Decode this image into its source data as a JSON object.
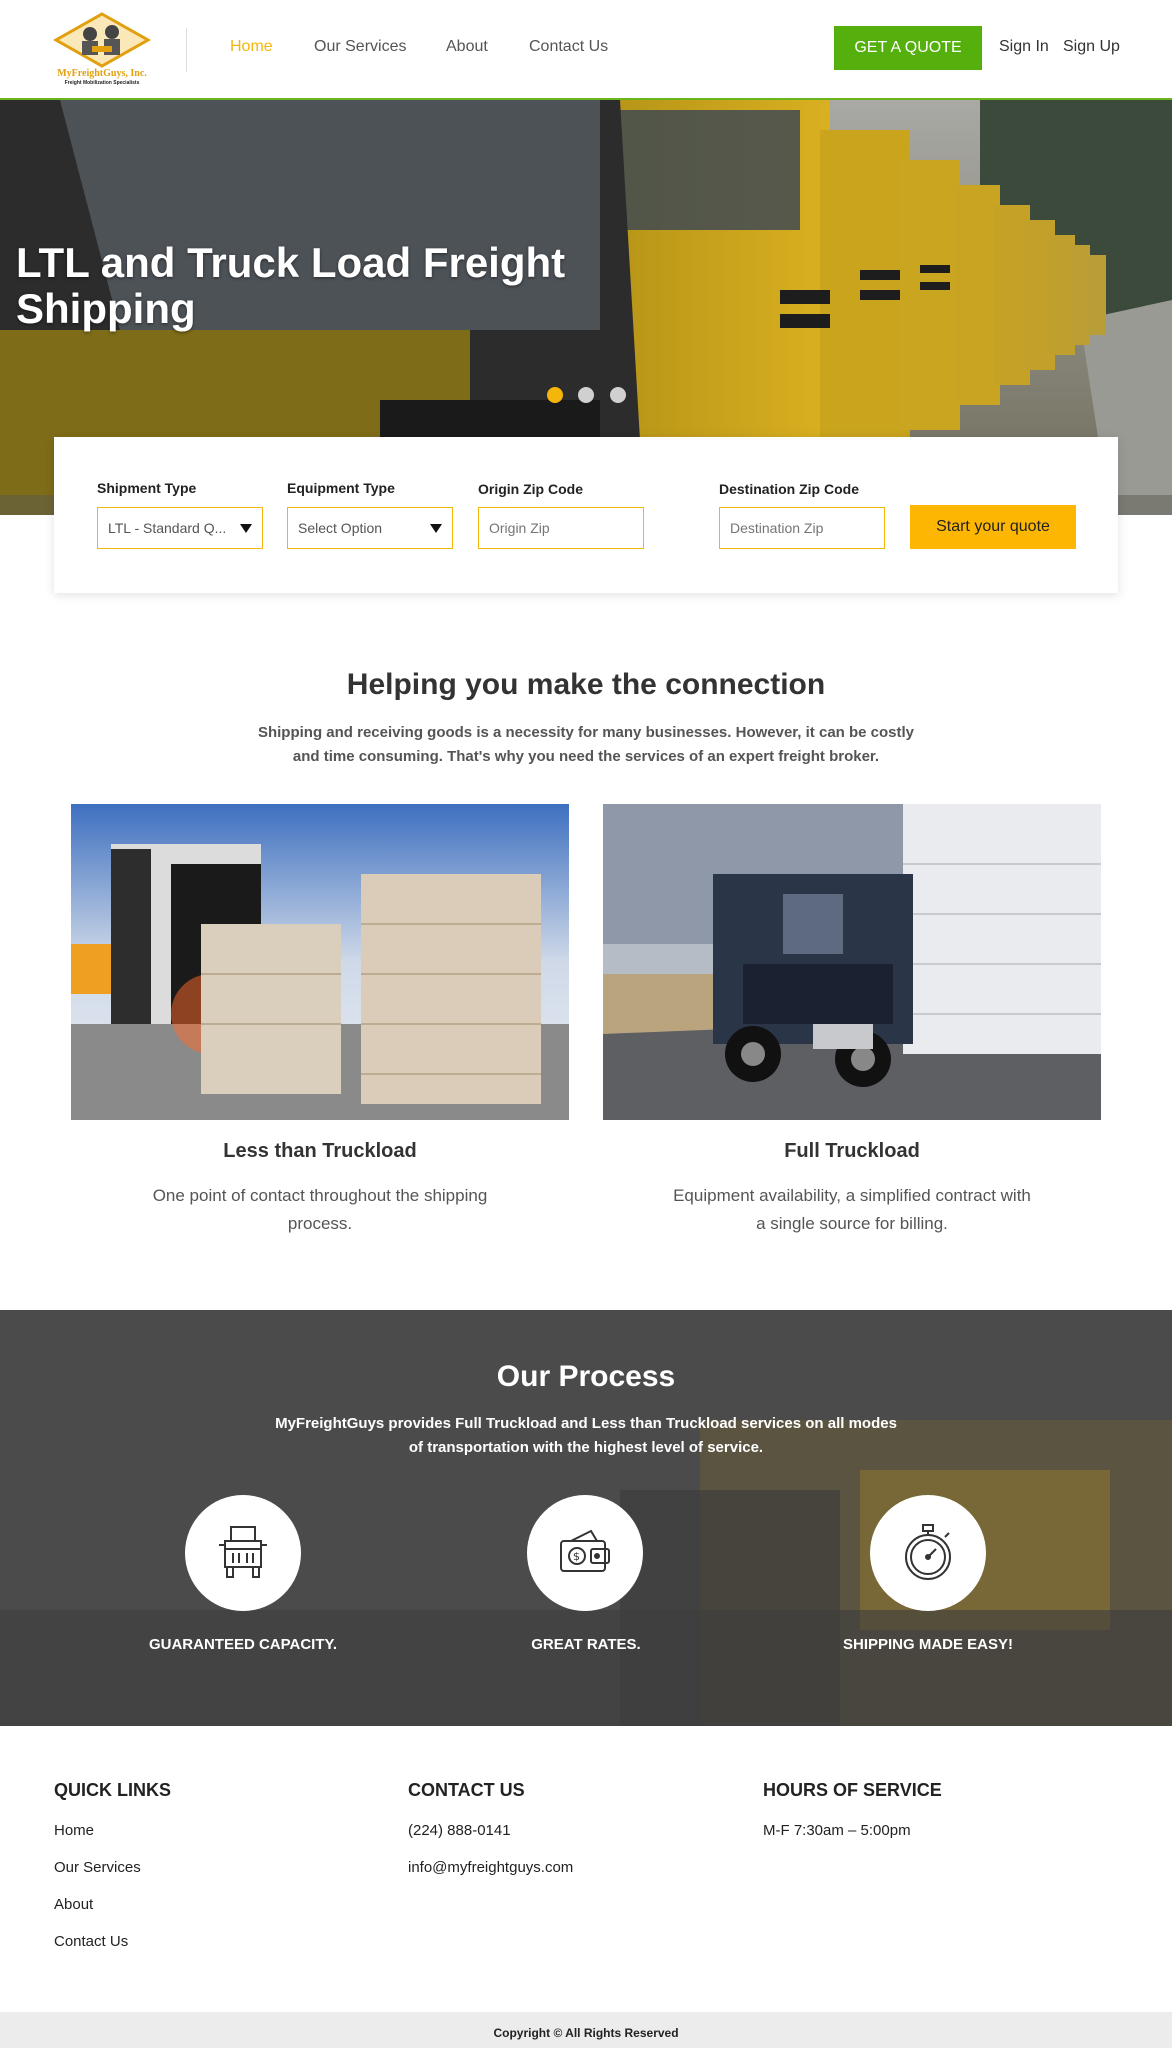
{
  "header": {
    "logo_text": "MyFreightGuys, Inc.",
    "logo_tagline": "Freight Mobilization Specialists",
    "nav": [
      {
        "label": "Home",
        "active": true
      },
      {
        "label": "Our Services",
        "active": false
      },
      {
        "label": "About",
        "active": false
      },
      {
        "label": "Contact Us",
        "active": false
      }
    ],
    "quote_button": "GET A QUOTE",
    "sign_in": "Sign In",
    "sign_up": "Sign Up"
  },
  "hero": {
    "title": "LTL and Truck Load Freight Shipping",
    "slides_total": 3,
    "active_slide": 1
  },
  "quote_form": {
    "shipment_label": "Shipment Type",
    "shipment_value": "LTL - Standard Q...",
    "equipment_label": "Equipment Type",
    "equipment_value": "Select Option",
    "origin_label": "Origin Zip Code",
    "origin_placeholder": "Origin Zip",
    "destination_label": "Destination Zip Code",
    "destination_placeholder": "Destination Zip",
    "submit": "Start your quote"
  },
  "connection": {
    "title": "Helping you make the connection",
    "description": "Shipping and receiving goods is a necessity for many businesses. However, it can be costly and time consuming. That's why you need the services of an expert freight broker.",
    "cards": [
      {
        "title": "Less than Truckload",
        "description": "One point of contact throughout the shipping process."
      },
      {
        "title": "Full Truckload",
        "description": "Equipment availability, a simplified contract with a single source for billing."
      }
    ]
  },
  "process": {
    "title": "Our Process",
    "description": "MyFreightGuys provides Full Truckload and Less than Truckload services on all modes of transportation with the highest level of service.",
    "items": [
      {
        "label": "GUARANTEED CAPACITY.",
        "icon": "truck-icon"
      },
      {
        "label": "GREAT RATES.",
        "icon": "wallet-icon"
      },
      {
        "label": "SHIPPING MADE EASY!",
        "icon": "stopwatch-icon"
      }
    ]
  },
  "footer": {
    "quick_links_title": "QUICK LINKS",
    "quick_links": [
      "Home",
      "Our Services",
      "About",
      "Contact Us"
    ],
    "contact_title": "CONTACT US",
    "phone": "(224) 888-0141",
    "email": "info@myfreightguys.com",
    "hours_title": "HOURS OF SERVICE",
    "hours": "M-F 7:30am – 5:00pm",
    "copyright": "Copyright © All Rights Reserved"
  },
  "colors": {
    "accent_yellow": "#f5b50a",
    "brand_green": "#55b00e",
    "button_yellow": "#fdb703"
  }
}
